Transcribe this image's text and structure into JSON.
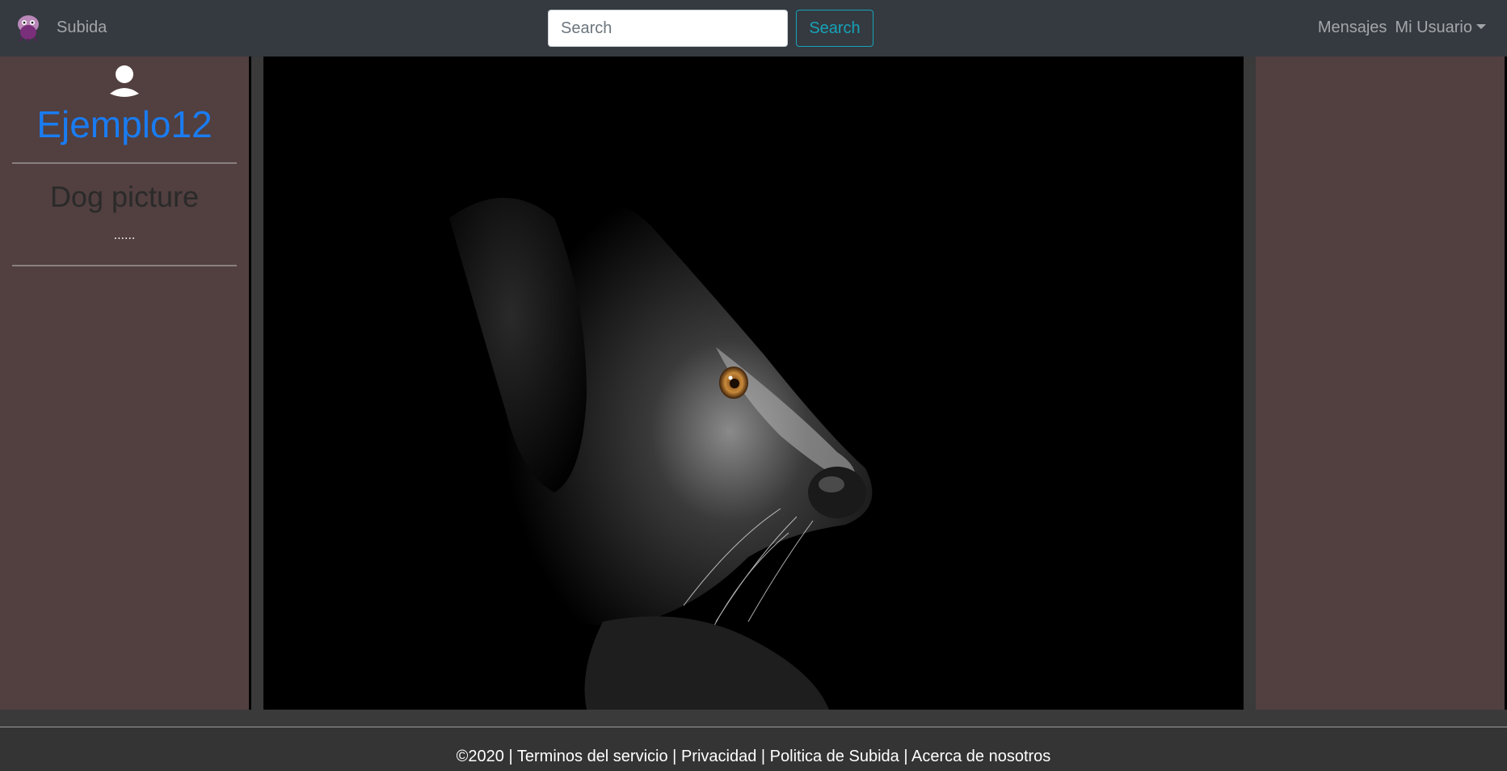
{
  "navbar": {
    "brand_label": "Subida",
    "logo_icon": "purple-creature-logo-icon",
    "search_placeholder": "Search",
    "search_button_label": "Search",
    "messages_label": "Mensajes",
    "user_menu_label": "Mi Usuario"
  },
  "profile": {
    "avatar_icon": "user-avatar-icon",
    "username": "Ejemplo12"
  },
  "post": {
    "title": "Dog picture",
    "description": "......",
    "image_subject": "black dog profile photo"
  },
  "footer": {
    "copyright": "©2020",
    "separator": "|",
    "links": [
      "Terminos del servicio",
      "Privacidad",
      "Politica de Subida",
      "Acerca de nosotros"
    ]
  },
  "colors": {
    "navbar_bg": "#343a40",
    "sidebar_bg": "#523f3f",
    "username_color": "#1a7cf2",
    "search_accent": "#17a2b8",
    "footer_bg": "#343434"
  }
}
